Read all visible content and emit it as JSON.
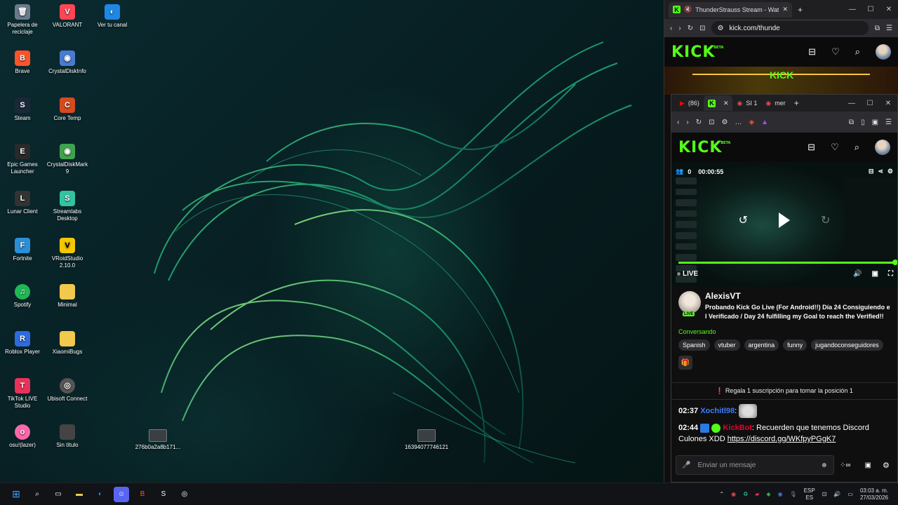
{
  "desktop": {
    "icons": [
      {
        "label": "Papelera de reciclaje",
        "glyph": "🗑",
        "color": "#6b7a8a"
      },
      {
        "label": "VALORANT",
        "glyph": "V",
        "color": "#ff4655"
      },
      {
        "label": "Ver tu canal",
        "glyph": "◐",
        "color": "#1e88e5"
      },
      {
        "label": "Brave",
        "glyph": "B",
        "color": "#fb542b"
      },
      {
        "label": "CrystalDiskInfo",
        "glyph": "◉",
        "color": "#4a7bd1"
      },
      {
        "label": "Steam",
        "glyph": "S",
        "color": "#1b2838"
      },
      {
        "label": "Core Temp",
        "glyph": "C",
        "color": "#d64a1e"
      },
      {
        "label": "Epic Games Launcher",
        "glyph": "E",
        "color": "#2a2a2a"
      },
      {
        "label": "CrystalDiskMark 9",
        "glyph": "◉",
        "color": "#3fa34d"
      },
      {
        "label": "Lunar Client",
        "glyph": "L",
        "color": "#333"
      },
      {
        "label": "Streamlabs Desktop",
        "glyph": "S",
        "color": "#31c3a2"
      },
      {
        "label": "Fortnite",
        "glyph": "F",
        "color": "#2b8fd6"
      },
      {
        "label": "VRoidStudio 2.10.0",
        "glyph": "V",
        "color": "#f4c700"
      },
      {
        "label": "Spotify",
        "glyph": "♫",
        "color": "#1db954"
      },
      {
        "label": "Minimal",
        "glyph": "▭",
        "color": "#f2c94c"
      },
      {
        "label": "Roblox Player",
        "glyph": "R",
        "color": "#2c6be0"
      },
      {
        "label": "XiaomiBugs",
        "glyph": "▭",
        "color": "#f2c94c"
      },
      {
        "label": "TikTok LIVE Studio",
        "glyph": "T",
        "color": "#e8315b"
      },
      {
        "label": "Ubisoft Connect",
        "glyph": "◎",
        "color": "#555"
      },
      {
        "label": "osu!(lazer)",
        "glyph": "o",
        "color": "#ff66aa"
      },
      {
        "label": "Sin título",
        "glyph": "▭",
        "color": "#444"
      }
    ],
    "files": [
      {
        "label": "276b0a2a8b171..."
      },
      {
        "label": "16394077746121"
      }
    ]
  },
  "window1": {
    "tab_title": "ThunderStrauss Stream - Wat",
    "url": "kick.com/thunde",
    "banner_text": "KICK"
  },
  "window2": {
    "tabs": [
      {
        "label": "(86)"
      },
      {
        "label": ""
      },
      {
        "label": "SI 1"
      },
      {
        "label": "mer"
      }
    ],
    "player": {
      "viewers": "0",
      "elapsed": "00:00:55",
      "live_label": "LIVE",
      "progress": 1.0
    },
    "stream": {
      "streamer": "AlexisVT",
      "live_badge": "LIVE",
      "title_line1": "Probando Kick Go Live (For Android!!) Día 24 Consiguiendo e",
      "title_line2": "l Verificado / Day 24 fulfilling my Goal to reach the Verified!!",
      "category": "Conversando",
      "tags": [
        "Spanish",
        "vtuber",
        "argentina",
        "funny",
        "jugandoconseguidores"
      ]
    },
    "chat": {
      "pinned": "Regala 1 suscripción para tomar la posición 1",
      "messages": [
        {
          "time": "02:37",
          "user": "Xochitl98",
          "text": ""
        },
        {
          "time": "02:44",
          "user": "KickBot",
          "text": "Recuerden que tenemos Discord Culones XDD",
          "link": "https://discord.gg/WKfpyPGgK7"
        }
      ],
      "input_placeholder": "Enviar un mensaje"
    }
  },
  "taskbar": {
    "lang_top": "ESP",
    "lang_bottom": "ES",
    "time": "03:03 a. m.",
    "date": "27/03/2026"
  },
  "colors": {
    "kick_green": "#53fc18"
  }
}
